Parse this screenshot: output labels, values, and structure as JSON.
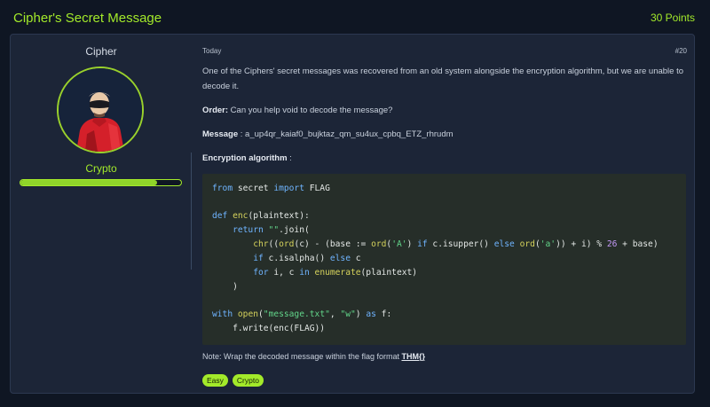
{
  "header": {
    "title": "Cipher's Secret Message",
    "points": "30 Points"
  },
  "sidebar": {
    "author": "Cipher",
    "category": "Crypto",
    "progress_percent": 85
  },
  "post": {
    "date": "Today",
    "number": "#20",
    "intro": "One of the Ciphers' secret messages was recovered from an old system alongside the encryption algorithm, but we are unable to decode it.",
    "order_label": "Order:",
    "order_text": " Can you help void to decode the message?",
    "message_label": "Message",
    "message_text": " : a_up4qr_kaiaf0_bujktaz_qm_su4ux_cpbq_ETZ_rhrudm",
    "algo_label": "Encryption algorithm",
    "algo_suffix": " :",
    "note_prefix": "Note: Wrap the decoded message within the flag format ",
    "note_format": "THM{}",
    "tags": [
      "Easy",
      "Crypto"
    ]
  },
  "code": {
    "l1_kw1": "from",
    "l1_a": " secret ",
    "l1_kw2": "import",
    "l1_b": " FLAG",
    "l3_kw": "def",
    "l3_a": " ",
    "l3_fn": "enc",
    "l3_b": "(plaintext):",
    "l4_ind": "    ",
    "l4_kw": "return",
    "l4_a": " ",
    "l4_str": "\"\"",
    "l4_b": ".join(",
    "l5_ind": "        ",
    "l5_f1": "chr",
    "l5_a": "((",
    "l5_f2": "ord",
    "l5_b": "(c) - (base := ",
    "l5_f3": "ord",
    "l5_c": "(",
    "l5_s1": "'A'",
    "l5_d": ") ",
    "l5_k1": "if",
    "l5_e": " c.isupper() ",
    "l5_k2": "else",
    "l5_f": " ",
    "l5_f4": "ord",
    "l5_g": "(",
    "l5_s2": "'a'",
    "l5_h": ")) + i) % ",
    "l5_n": "26",
    "l5_i": " + base)",
    "l6_ind": "        ",
    "l6_k1": "if",
    "l6_a": " c.isalpha() ",
    "l6_k2": "else",
    "l6_b": " c",
    "l7_ind": "        ",
    "l7_k1": "for",
    "l7_a": " i, c ",
    "l7_k2": "in",
    "l7_b": " ",
    "l7_f": "enumerate",
    "l7_c": "(plaintext)",
    "l8": "    )",
    "l10_kw": "with",
    "l10_a": " ",
    "l10_f": "open",
    "l10_b": "(",
    "l10_s1": "\"message.txt\"",
    "l10_c": ", ",
    "l10_s2": "\"w\"",
    "l10_d": ") ",
    "l10_k2": "as",
    "l10_e": " f:",
    "l11": "    f.write(enc(FLAG))"
  },
  "colors": {
    "accent": "#a3ea2a",
    "card": "#1c2537",
    "code_bg": "#262e29"
  }
}
